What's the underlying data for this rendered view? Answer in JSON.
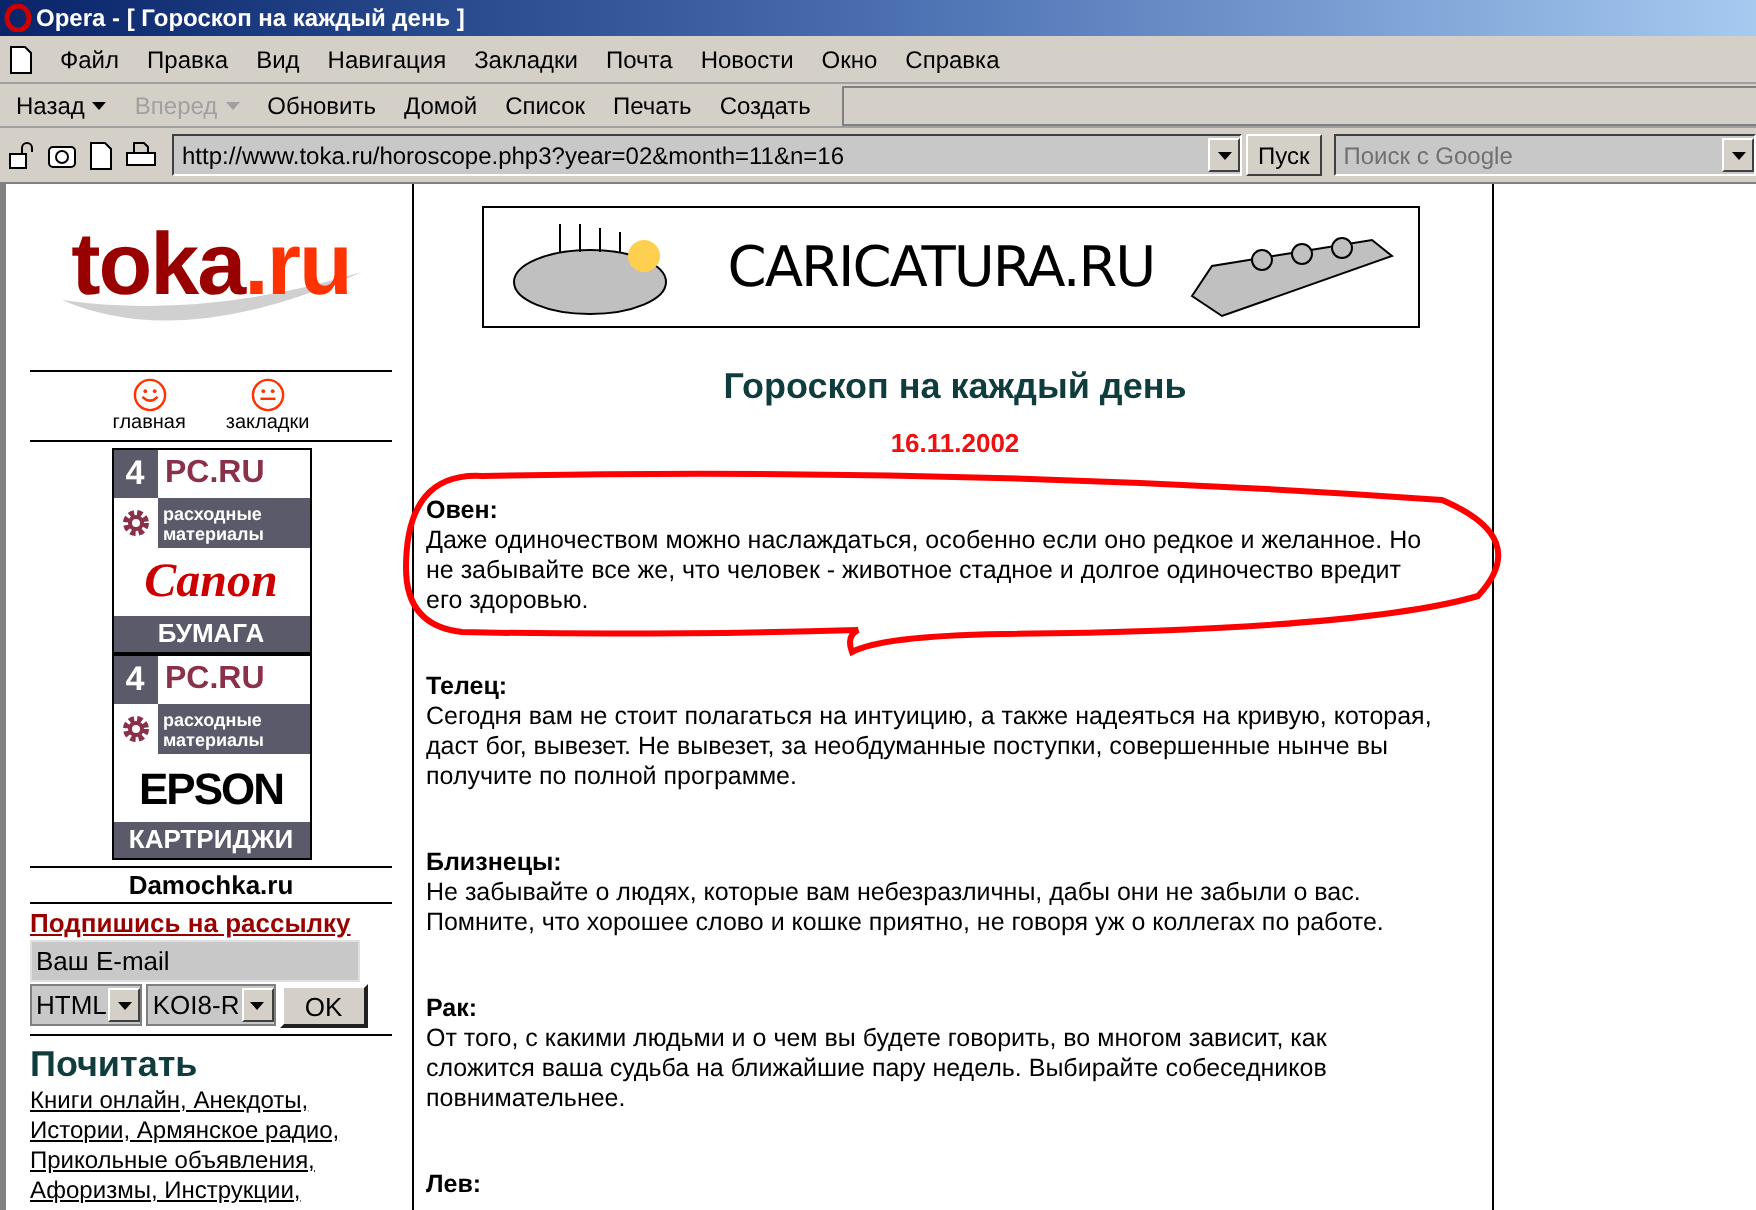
{
  "window": {
    "title": "Opera - [ Гороскоп на каждый день ]"
  },
  "menu": [
    "Файл",
    "Правка",
    "Вид",
    "Навигация",
    "Закладки",
    "Почта",
    "Новости",
    "Окно",
    "Справка"
  ],
  "toolbar": [
    {
      "label": "Назад",
      "disabled": false,
      "dropdown": true
    },
    {
      "label": "Вперед",
      "disabled": true,
      "dropdown": true
    },
    {
      "label": "Обновить",
      "disabled": false,
      "dropdown": false
    },
    {
      "label": "Домой",
      "disabled": false,
      "dropdown": false
    },
    {
      "label": "Список",
      "disabled": false,
      "dropdown": false
    },
    {
      "label": "Печать",
      "disabled": false,
      "dropdown": false
    },
    {
      "label": "Создать",
      "disabled": false,
      "dropdown": false
    }
  ],
  "address_bar": {
    "url": "http://www.toka.ru/horoscope.php3?year=02&month=11&n=16",
    "go_button": "Пуск",
    "search_placeholder": "Поиск с Google"
  },
  "sidebar": {
    "logo": {
      "name": "toka",
      "tld": ".ru"
    },
    "nav_links": [
      {
        "label": "главная",
        "kind": "smile"
      },
      {
        "label": "закладки",
        "kind": "neutral"
      }
    ],
    "ads": [
      {
        "number": "4",
        "site": "PC.RU",
        "tagline_1": "расходные",
        "tagline_2": "материалы",
        "brand": "Canon",
        "kind": "script",
        "product": "БУМАГА"
      },
      {
        "number": "4",
        "site": "PC.RU",
        "tagline_1": "расходные",
        "tagline_2": "материалы",
        "brand": "EPSON",
        "kind": "block",
        "product": "КАРТРИДЖИ"
      }
    ],
    "partner": "Damochka.ru",
    "subscribe": {
      "title": "Подпишись на рассылку",
      "email": "Ваш E-mail",
      "format": "HTML",
      "encoding": "KOI8-R",
      "button": "OK"
    },
    "read": {
      "title": "Почитать",
      "links": [
        "Книги онлайн, Анекдоты,",
        "Истории, Армянское радио,",
        "Прикольные объявления,",
        "Афоризмы, Инструкции,"
      ]
    }
  },
  "main": {
    "banner": "CARICATURA.RU",
    "title": "Гороскоп на каждый день",
    "date": "16.11.2002",
    "horoscopes": [
      {
        "sign": "Овен:",
        "text": "Даже одиночеством можно наслаждаться, особенно если оно редкое и желанное. Но не забывайте все же, что человек - животное стадное и долгое одиночество вредит его здоровью."
      },
      {
        "sign": "Телец:",
        "text": "Сегодня вам не стоит полагаться на интуицию, а также надеяться на кривую, которая, даст бог, вывезет. Не вывезет, за необдуманные поступки, совершенные нынче вы получите по полной программе."
      },
      {
        "sign": "Близнецы:",
        "text": "Не забывайте о людях, которые вам небезразличны, дабы они не забыли о вас. Помните, что хорошее слово и кошке приятно, не говоря уж о коллегах по работе."
      },
      {
        "sign": "Рак:",
        "text": "От того, с какими людьми и о чем вы будете говорить, во многом зависит, как сложится ваша судьба на ближайшие пару недель. Выбирайте собеседников повнимательнее."
      },
      {
        "sign": "Лев:"
      }
    ]
  }
}
